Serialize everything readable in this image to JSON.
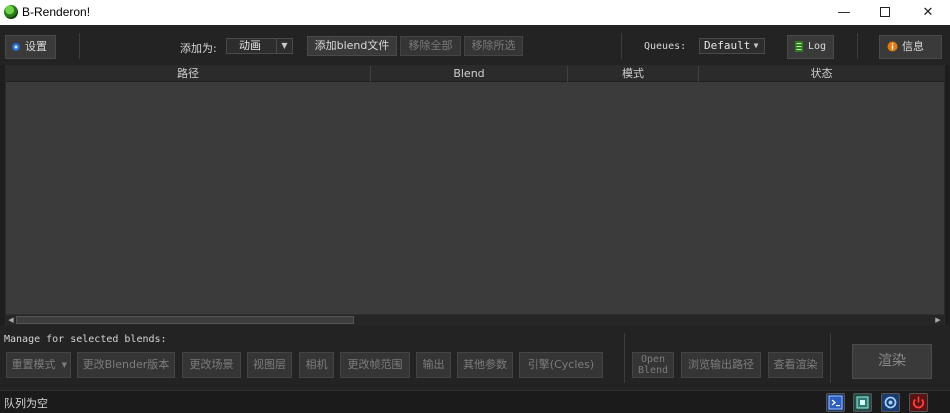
{
  "window": {
    "title": "B-Renderon!",
    "minimize": "—",
    "close": "✕"
  },
  "toolbar": {
    "settings_label": "设置",
    "add_as_label": "添加为:",
    "add_as_value": "动画",
    "add_blend_label": "添加blend文件",
    "remove_all_label": "移除全部",
    "remove_selected_label": "移除所选",
    "queues_label": "Queues:",
    "queues_value": "Default",
    "log_label": "Log",
    "info_label": "信息"
  },
  "table": {
    "columns": [
      "路径",
      "Blend",
      "模式",
      "状态"
    ]
  },
  "bottom": {
    "manage_label": "Manage for selected blends:",
    "buttons": {
      "reset_mode": "重置模式",
      "change_blender": "更改Blender版本",
      "change_scene": "更改场景",
      "view_layer": "视图层",
      "camera": "相机",
      "change_frames": "更改帧范围",
      "output": "输出",
      "other_params": "其他参数",
      "engine": "引擎(Cycles)",
      "open_blend_line1": "Open",
      "open_blend_line2": "Blend",
      "browse_output": "浏览输出路径",
      "view_render": "查看渲染",
      "render": "渲染"
    }
  },
  "status": {
    "text": "队列为空"
  },
  "colors": {
    "accent_green": "#3fae2a",
    "info_orange": "#e07a10",
    "power_red": "#d42020",
    "terminal_blue": "#2a5fbf"
  }
}
